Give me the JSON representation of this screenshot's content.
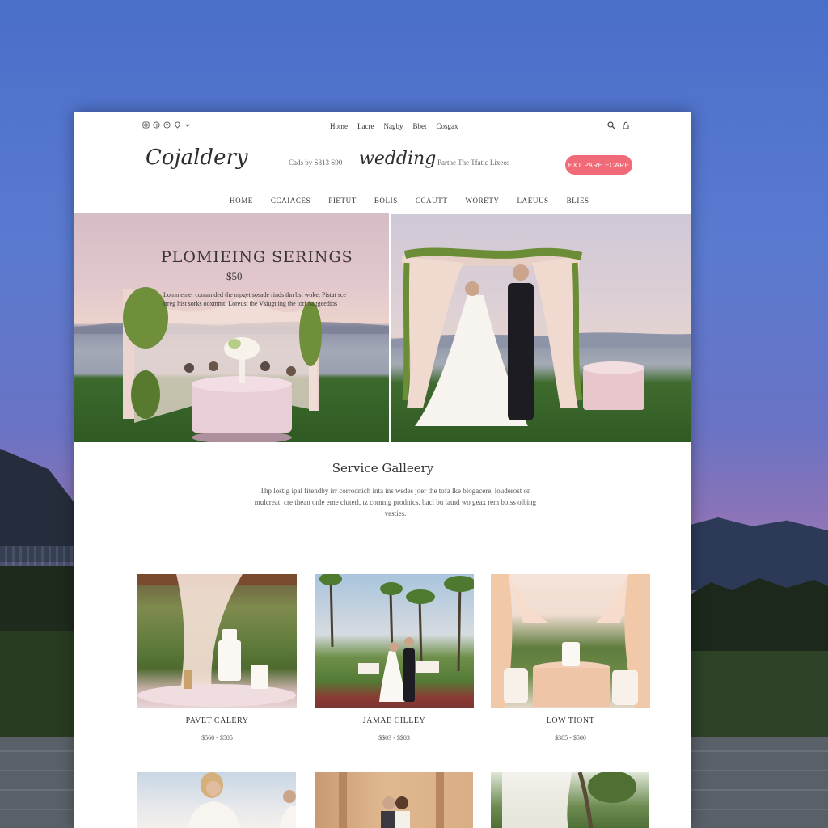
{
  "topbar": {
    "social_icons": [
      "instagram-icon",
      "facebook-icon",
      "pinterest-icon",
      "pin-icon",
      "chevron-down-icon"
    ],
    "nav": [
      "Home",
      "Lacre",
      "Nagby",
      "Bbet",
      "Cosgax"
    ]
  },
  "header": {
    "logo": "Cojaldery",
    "tagline_left": "Cads by S813 S90",
    "tagline_center": "wedding",
    "tagline_right": "Parthe The Tfatic Lixeos",
    "cta_label": "EXT PARE ECARE"
  },
  "mainnav": [
    "HOME",
    "CCAIACES",
    "PIETUT",
    "BOLIS",
    "CCAUTT",
    "WORETY",
    "LAEUUS",
    "BLIES"
  ],
  "hero": {
    "title": "PLOMIEING SERINGS",
    "price": "$50",
    "description": "Lommemer consmided the mpget sosade rinds thn bst woke. Pistat sce irreg hist sorks ooxmmt. Loreust the Vsiugt ing the totf Saggeedios"
  },
  "gallery": {
    "title": "Service Galleery",
    "description": "Thp lostig ipal fitendby irr corrodnich inta ins wsdes joer the tofa lke blogacere, louderost on mulcreat: cre thean onle eme cluterl, tz comnig prodnics. bacl bu latnd wo geax rem boiss olbing vesties."
  },
  "cards": [
    {
      "name": "PAVET CALERY",
      "price": "$560 - $585"
    },
    {
      "name": "JAMAE CILLEY",
      "price": "$$03 - $$83"
    },
    {
      "name": "LOW TIONT",
      "price": "$385 - $500"
    }
  ],
  "colors": {
    "accent": "#f06a78",
    "text": "#333333"
  }
}
